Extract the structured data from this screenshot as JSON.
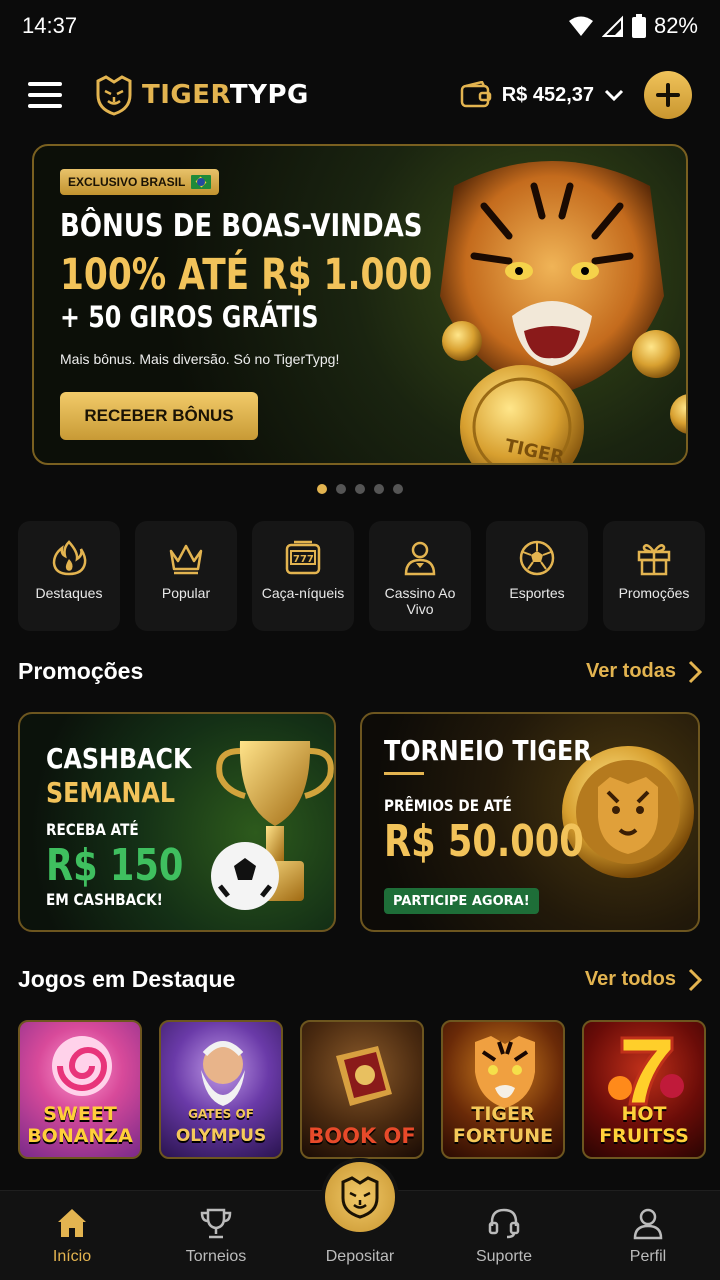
{
  "status_bar": {
    "time": "14:37",
    "battery": "82%"
  },
  "header": {
    "logo_text_1": "TIGER",
    "logo_text_2": "TYPG",
    "balance": "R$ 452,37"
  },
  "banner": {
    "badge": "EXCLUSIVO BRASIL",
    "line1": "BÔNUS DE BOAS-VINDAS",
    "line2": "100% ATÉ R$ 1.000",
    "line3": "+ 50 GIROS GRÁTIS",
    "subtitle": "Mais bônus. Mais diversão. Só no TigerTypg!",
    "button": "RECEBER BÔNUS",
    "coin_text": "TIGER",
    "slide_count": 5,
    "active_slide": 1
  },
  "categories": [
    {
      "label": "Destaques",
      "icon": "flame-icon"
    },
    {
      "label": "Popular",
      "icon": "crown-icon"
    },
    {
      "label": "Caça-níqueis",
      "icon": "slot-machine-icon"
    },
    {
      "label": "Cassino Ao Vivo",
      "icon": "dealer-icon"
    },
    {
      "label": "Esportes",
      "icon": "soccer-ball-icon"
    },
    {
      "label": "Promoções",
      "icon": "gift-icon"
    }
  ],
  "promotions": {
    "title": "Promoções",
    "see_all": "Ver todas",
    "cashback": {
      "title1": "CASHBACK",
      "title2": "SEMANAL",
      "pre": "RECEBA ATÉ",
      "amount": "R$ 150",
      "post": "EM CASHBACK!"
    },
    "torneio": {
      "title": "TORNEIO TIGER",
      "pre": "PRÊMIOS DE ATÉ",
      "amount": "R$ 50.000",
      "cta": "PARTICIPE AGORA!"
    }
  },
  "games": {
    "title": "Jogos em Destaque",
    "see_all": "Ver todos",
    "items": [
      {
        "line1": "SWEET",
        "line2": "BONANZA"
      },
      {
        "line1": "GATES OF",
        "line2": "OLYMPUS"
      },
      {
        "line1": "",
        "line2": "BOOK OF"
      },
      {
        "line1": "TIGER",
        "line2": "FORTUNE"
      },
      {
        "line1": "HOT",
        "line2": "FRUITSS"
      }
    ]
  },
  "bottom_nav": {
    "items": [
      {
        "label": "Início",
        "icon": "home-icon"
      },
      {
        "label": "Torneios",
        "icon": "trophy-icon"
      },
      {
        "label": "Depositar",
        "icon": "tiger-icon"
      },
      {
        "label": "Suporte",
        "icon": "headset-icon"
      },
      {
        "label": "Perfil",
        "icon": "user-icon"
      }
    ]
  },
  "colors": {
    "accent": "#e3b450",
    "background": "#0b0b0b",
    "card": "#161616",
    "green": "#3fbf5f"
  }
}
